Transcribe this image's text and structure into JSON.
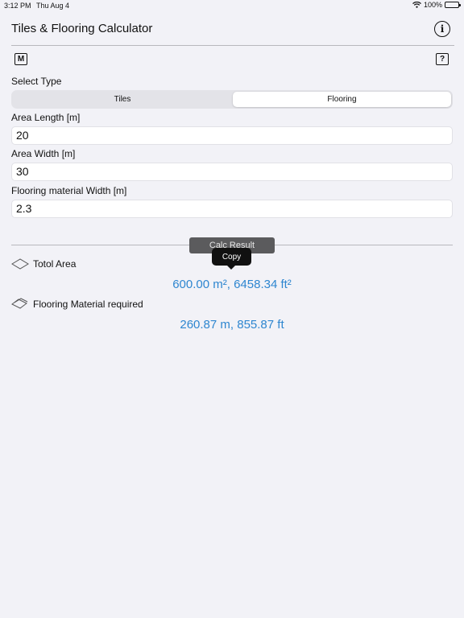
{
  "status_bar": {
    "time": "3:12 PM",
    "date": "Thu Aug 4",
    "battery": "100%",
    "battery_level": 1.0,
    "wifi_icon": "wifi-icon",
    "battery_icon": "battery-icon"
  },
  "nav": {
    "title": "Tiles & Flooring Calculator",
    "info_icon": "info-icon",
    "info_glyph": "i"
  },
  "toolbar": {
    "memory_label": "M",
    "help_label": "?"
  },
  "form": {
    "select_type_label": "Select Type",
    "segments": [
      {
        "label": "Tiles",
        "selected": false
      },
      {
        "label": "Flooring",
        "selected": true
      }
    ],
    "area_length_label": "Area Length [m]",
    "area_length_value": "20",
    "area_width_label": "Area Width [m]",
    "area_width_value": "30",
    "material_width_label": "Flooring material Width [m]",
    "material_width_value": "2.3"
  },
  "results": {
    "calc_button_label": "Calc Result",
    "copy_tooltip": "Copy",
    "total_area_label": "Totol Area",
    "total_area_value": "600.00 m², 6458.34 ft²",
    "material_label": "Flooring Material required",
    "material_value": "260.87 m, 855.87 ft"
  },
  "colors": {
    "accent": "#2e86d0",
    "background": "#f2f2f7"
  }
}
